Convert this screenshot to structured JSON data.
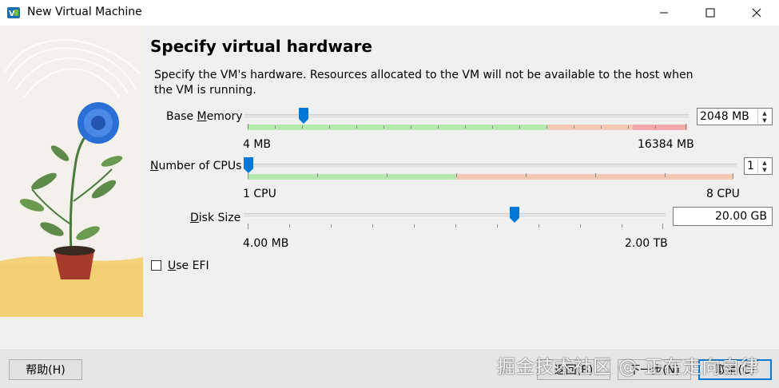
{
  "window": {
    "title": "New Virtual Machine"
  },
  "page": {
    "heading": "Specify virtual hardware",
    "description": "Specify the VM's hardware. Resources allocated to the VM will not be available to the host when the VM is running."
  },
  "base_memory": {
    "label_prefix": "Base ",
    "label_mnemonic": "M",
    "label_suffix": "emory",
    "min_label": "4 MB",
    "max_label": "16384 MB",
    "value": "2048 MB",
    "level_fraction": 0.125
  },
  "cpus": {
    "label_mnemonic": "N",
    "label_suffix": "umber of CPUs",
    "min_label": "1 CPU",
    "max_label": "8 CPU",
    "value": "1",
    "level_fraction": 0
  },
  "disk": {
    "label_mnemonic": "D",
    "label_suffix": "isk Size",
    "min_label": "4.00 MB",
    "max_label": "2.00 TB",
    "value": "20.00 GB"
  },
  "efi": {
    "label_mnemonic": "U",
    "label_suffix": "se EFI",
    "checked": false
  },
  "footer": {
    "help_label": "帮助(H)",
    "back_label": "返回(B)",
    "next_label": "下一步(N)",
    "cancel_label": "取消(C)"
  },
  "watermark": "掘金技术社区 @ 正在走向自律",
  "colors": {
    "accent": "#0078d7",
    "zone_green": "#b6e8b0",
    "zone_orange": "#f3c9b4",
    "zone_red": "#f2a8a8"
  }
}
